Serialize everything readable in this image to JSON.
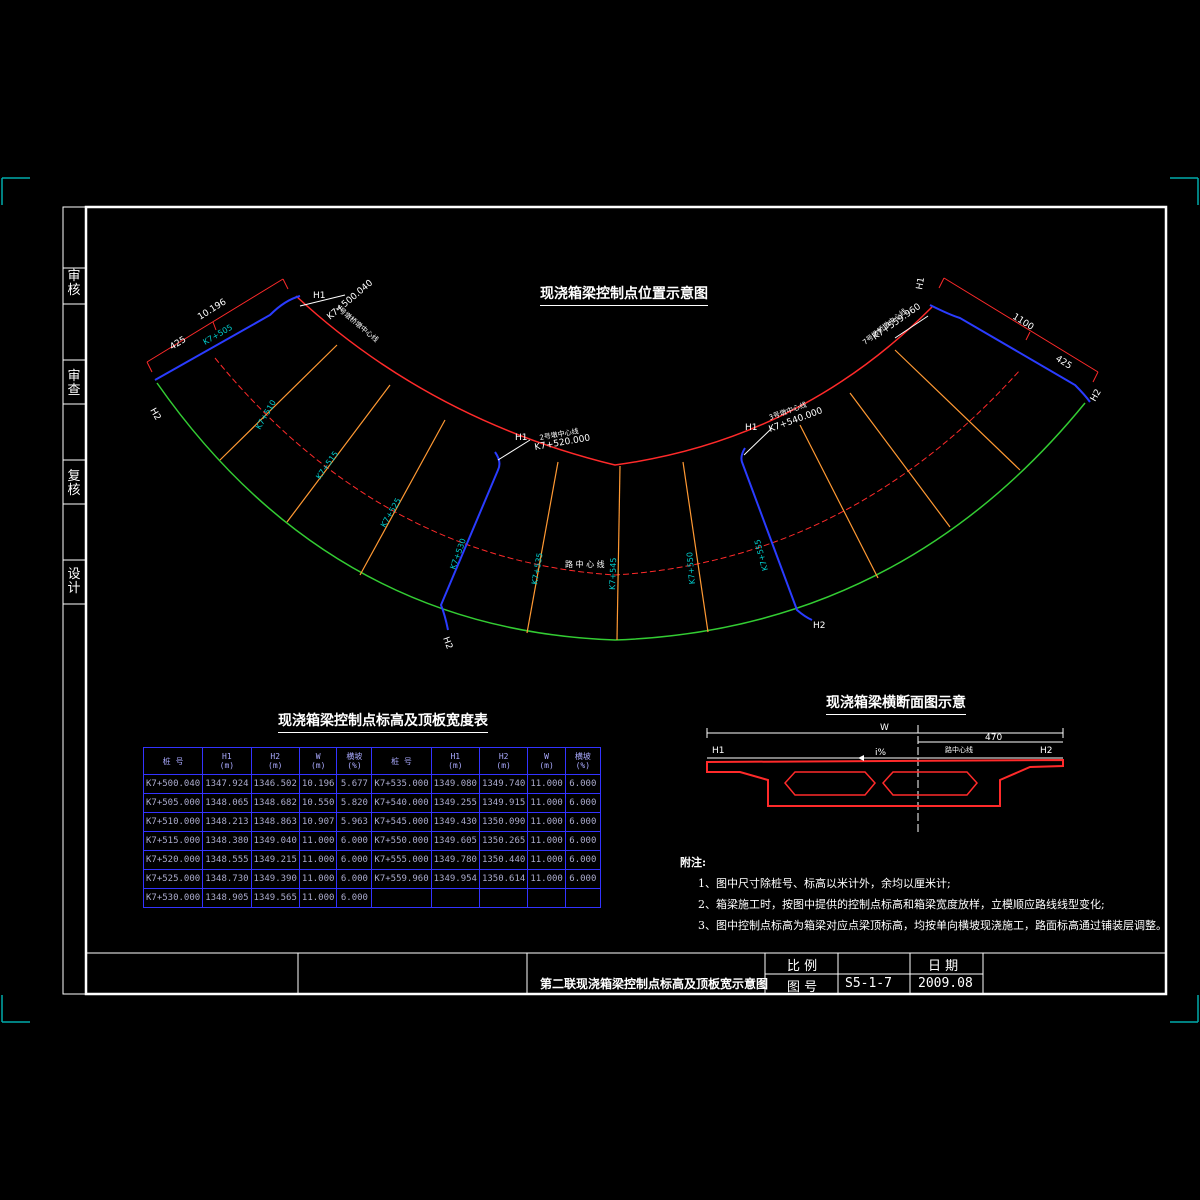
{
  "plan_title": "现浇箱梁控制点位置示意图",
  "section_title": "现浇箱梁横断面图示意",
  "table_title": "现浇箱梁控制点标高及顶板宽度表",
  "side_labels": [
    "审 核",
    "审 查",
    "复 核",
    "设 计"
  ],
  "table": {
    "headers": [
      "桩 号",
      "H1\n(m)",
      "H2\n(m)",
      "W\n(m)",
      "横坡\n(%)",
      "桩 号",
      "H1\n(m)",
      "H2\n(m)",
      "W\n(m)",
      "横坡\n(%)"
    ],
    "rows": [
      [
        "K7+500.040",
        "1347.924",
        "1346.502",
        "10.196",
        "5.677",
        "K7+535.000",
        "1349.080",
        "1349.740",
        "11.000",
        "6.000"
      ],
      [
        "K7+505.000",
        "1348.065",
        "1348.682",
        "10.550",
        "5.820",
        "K7+540.000",
        "1349.255",
        "1349.915",
        "11.000",
        "6.000"
      ],
      [
        "K7+510.000",
        "1348.213",
        "1348.863",
        "10.907",
        "5.963",
        "K7+545.000",
        "1349.430",
        "1350.090",
        "11.000",
        "6.000"
      ],
      [
        "K7+515.000",
        "1348.380",
        "1349.040",
        "11.000",
        "6.000",
        "K7+550.000",
        "1349.605",
        "1350.265",
        "11.000",
        "6.000"
      ],
      [
        "K7+520.000",
        "1348.555",
        "1349.215",
        "11.000",
        "6.000",
        "K7+555.000",
        "1349.780",
        "1350.440",
        "11.000",
        "6.000"
      ],
      [
        "K7+525.000",
        "1348.730",
        "1349.390",
        "11.000",
        "6.000",
        "K7+559.960",
        "1349.954",
        "1350.614",
        "11.000",
        "6.000"
      ],
      [
        "K7+530.000",
        "1348.905",
        "1349.565",
        "11.000",
        "6.000",
        "",
        "",
        "",
        "",
        ""
      ]
    ]
  },
  "notes": {
    "heading": "附注:",
    "items": [
      "1、图中尺寸除桩号、标高以米计外，余均以厘米计;",
      "2、箱梁施工时，按图中提供的控制点标高和箱梁宽度放样，立模顺应路线线型变化;",
      "3、图中控制点标高为箱梁对应点梁顶标高，均按单向横坡现浇施工，路面标高通过铺装层调整。"
    ]
  },
  "plan": {
    "left_end": "K7+500.040",
    "mid_pier": "K7+520.000",
    "right_pier": "K7+540.000",
    "right_end": "K7+559.960",
    "dim_left_total": "10.196",
    "dim_left_half": "425",
    "dim_right_total": "1100",
    "dim_right_half": "425",
    "centerline_label": "路 中 心 线",
    "left_end_note": "1号墩桥墩中心线",
    "mid_pier_note": "2号墩中心线",
    "right_pier_note": "3号墩中心线",
    "right_end_note": "7号墩桥墩中心线",
    "station_ticks": [
      "K7+505",
      "K7+510",
      "K7+515",
      "K7+525",
      "K7+530",
      "K7+535",
      "K7+545",
      "K7+550",
      "K7+555"
    ],
    "h1": "H1",
    "h2": "H2"
  },
  "section": {
    "width_label": "W",
    "half_label": "470",
    "slope_label": "i%",
    "centerline_label": "路中心线",
    "h1": "H1",
    "h2": "H2"
  },
  "title_block": {
    "drawing_title": "第二联现浇箱梁控制点标高及顶板宽示意图",
    "scale_label": "比 例",
    "date_label": "日 期",
    "number_label": "图 号",
    "number": "S5-1-7",
    "date": "2009.08"
  },
  "colors": {
    "frame": "#ffffff",
    "centerline_arc": "#ff2a2a",
    "outer_arc": "#33cc33",
    "inner_arc": "#ff2a2a",
    "radial": "#ff9933",
    "pier": "#2a3cff",
    "label": "#00cccc",
    "table_grid": "#3333ff",
    "corner_mark": "#00aaaa"
  }
}
